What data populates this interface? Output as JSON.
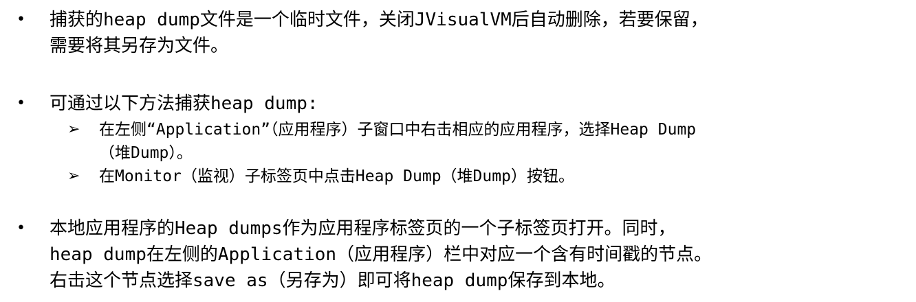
{
  "bullets": [
    {
      "marker": "•",
      "lines": [
        "捕获的heap dump文件是一个临时文件，关闭JVisualVM后自动删除，若要保留，",
        "需要将其另存为文件。"
      ]
    },
    {
      "marker": "•",
      "lines": [
        "可通过以下方法捕获heap dump:"
      ],
      "sub_items": [
        {
          "marker": "➢",
          "lines": [
            "在左侧“Application”（应用程序）子窗口中右击相应的应用程序，选择Heap Dump",
            "（堆Dump）。"
          ]
        },
        {
          "marker": "➢",
          "lines": [
            "在Monitor（监视）子标签页中点击Heap Dump（堆Dump）按钮。"
          ]
        }
      ]
    },
    {
      "marker": "•",
      "lines": [
        "本地应用程序的Heap dumps作为应用程序标签页的一个子标签页打开。同时，",
        "heap dump在左侧的Application（应用程序）栏中对应一个含有时间戳的节点。",
        "右击这个节点选择save as（另存为）即可将heap dump保存到本地。"
      ]
    }
  ]
}
